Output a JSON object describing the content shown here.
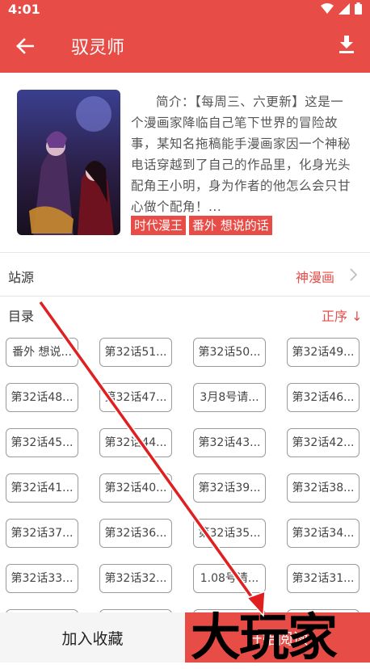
{
  "status": {
    "time": "4:01"
  },
  "appbar": {
    "title": "驭灵师"
  },
  "comic": {
    "intro": "简介：【每周三、六更新】这是一个漫画家降临自己笔下世界的冒险故事，某知名拖稿能手漫画家因一个神秘电话穿越到了自己的作品里，化身光头配角王小明，身为作者的他怎么会只甘心做个配角！...",
    "tags": [
      "时代漫王",
      "番外 想说的话"
    ]
  },
  "source": {
    "label": "站源",
    "value": "神漫画"
  },
  "catalog": {
    "label": "目录",
    "order": "正序 ↓",
    "chapters": [
      "番外 想说...",
      "第32话51...",
      "第32话50...",
      "第32话49...",
      "第32话48...",
      "第32话47...",
      "3月8号请...",
      "第32话46...",
      "第32话45...",
      "第32话44...",
      "第32话43...",
      "第32话42...",
      "第32话41...",
      "第32话40...",
      "第32话39...",
      "第32话38...",
      "第32话37...",
      "第32话36...",
      "第32话35...",
      "第32话34...",
      "第32话33...",
      "第32话32...",
      "1.08号请...",
      "第32话31..."
    ]
  },
  "bottom": {
    "favorite": "加入收藏",
    "read": "开始阅读"
  },
  "watermark": "大玩家",
  "colors": {
    "accent": "#e84c47"
  }
}
